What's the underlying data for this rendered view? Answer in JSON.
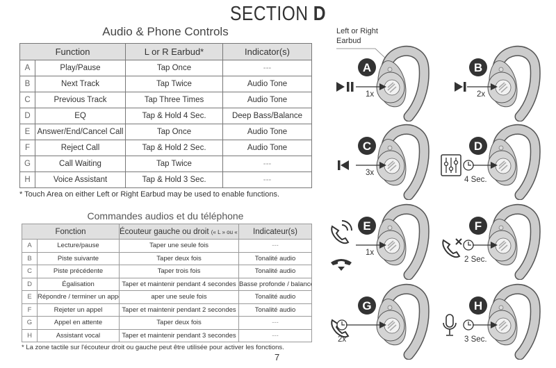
{
  "section": {
    "prefix": "SECTION",
    "letter": "D"
  },
  "english": {
    "title": "Audio & Phone Controls",
    "headers": [
      "Function",
      "L or R Earbud*",
      "Indicator(s)"
    ],
    "rows": [
      [
        "A",
        "Play/Pause",
        "Tap Once",
        "---"
      ],
      [
        "B",
        "Next Track",
        "Tap Twice",
        "Audio Tone"
      ],
      [
        "C",
        "Previous Track",
        "Tap Three Times",
        "Audio Tone"
      ],
      [
        "D",
        "EQ",
        "Tap & Hold 4 Sec.",
        "Deep Bass/Balance"
      ],
      [
        "E",
        "Answer/End/Cancel Call",
        "Tap Once",
        "Audio Tone"
      ],
      [
        "F",
        "Reject Call",
        "Tap & Hold 2 Sec.",
        "Audio Tone"
      ],
      [
        "G",
        "Call Waiting",
        "Tap Twice",
        "---"
      ],
      [
        "H",
        "Voice Assistant",
        "Tap & Hold 3 Sec.",
        "---"
      ]
    ],
    "footnote": "* Touch Area on either Left or Right Earbud may be used to enable functions."
  },
  "french": {
    "title": "Commandes audios et du téléphone",
    "headers": [
      "Fonction",
      "Écouteur gauche ou droit",
      "(« L » ou « R »)*",
      "Indicateur(s)"
    ],
    "rows": [
      [
        "A",
        "Lecture/pause",
        "Taper une seule fois",
        "---"
      ],
      [
        "B",
        "Piste suivante",
        "Taper deux fois",
        "Tonalité audio"
      ],
      [
        "C",
        "Piste précédente",
        "Taper trois fois",
        "Tonalité audio"
      ],
      [
        "D",
        "Égalisation",
        "Taper et maintenir pendant 4 secondes",
        "Basse profonde / balance"
      ],
      [
        "E",
        "Répondre / terminer un appel",
        "aper une seule fois",
        "Tonalité audio"
      ],
      [
        "F",
        "Rejeter un appel",
        "Taper et maintenir pendant 2 secondes",
        "Tonalité audio"
      ],
      [
        "G",
        "Appel en attente",
        "Taper deux fois",
        "---"
      ],
      [
        "H",
        "Assistant vocal",
        "Taper et maintenir pendant 3 secondes",
        "---"
      ]
    ],
    "footnote": "* La zone tactile sur l'écouteur droit ou gauche peut être utilisée pour activer les fonctions."
  },
  "page_number": "7",
  "callout": {
    "line1": "Left or Right",
    "line2": "Earbud"
  },
  "panels": [
    {
      "letter": "A",
      "tap": "1x",
      "icon": "play-pause-icon"
    },
    {
      "letter": "B",
      "tap": "2x",
      "icon": "next-track-icon"
    },
    {
      "letter": "C",
      "tap": "3x",
      "icon": "previous-track-icon"
    },
    {
      "letter": "D",
      "tap": "4 Sec.",
      "icon": "equalizer-icon"
    },
    {
      "letter": "E",
      "tap": "1x",
      "icon": "phone-answer-end-icon"
    },
    {
      "letter": "F",
      "tap": "2 Sec.",
      "icon": "reject-call-icon"
    },
    {
      "letter": "G",
      "tap": "2x",
      "icon": "call-waiting-icon"
    },
    {
      "letter": "H",
      "tap": "3 Sec.",
      "icon": "microphone-icon"
    }
  ],
  "colors": {
    "badge": "#333333",
    "earbud": "#cccccc",
    "header_bg": "#e0e0e0"
  }
}
